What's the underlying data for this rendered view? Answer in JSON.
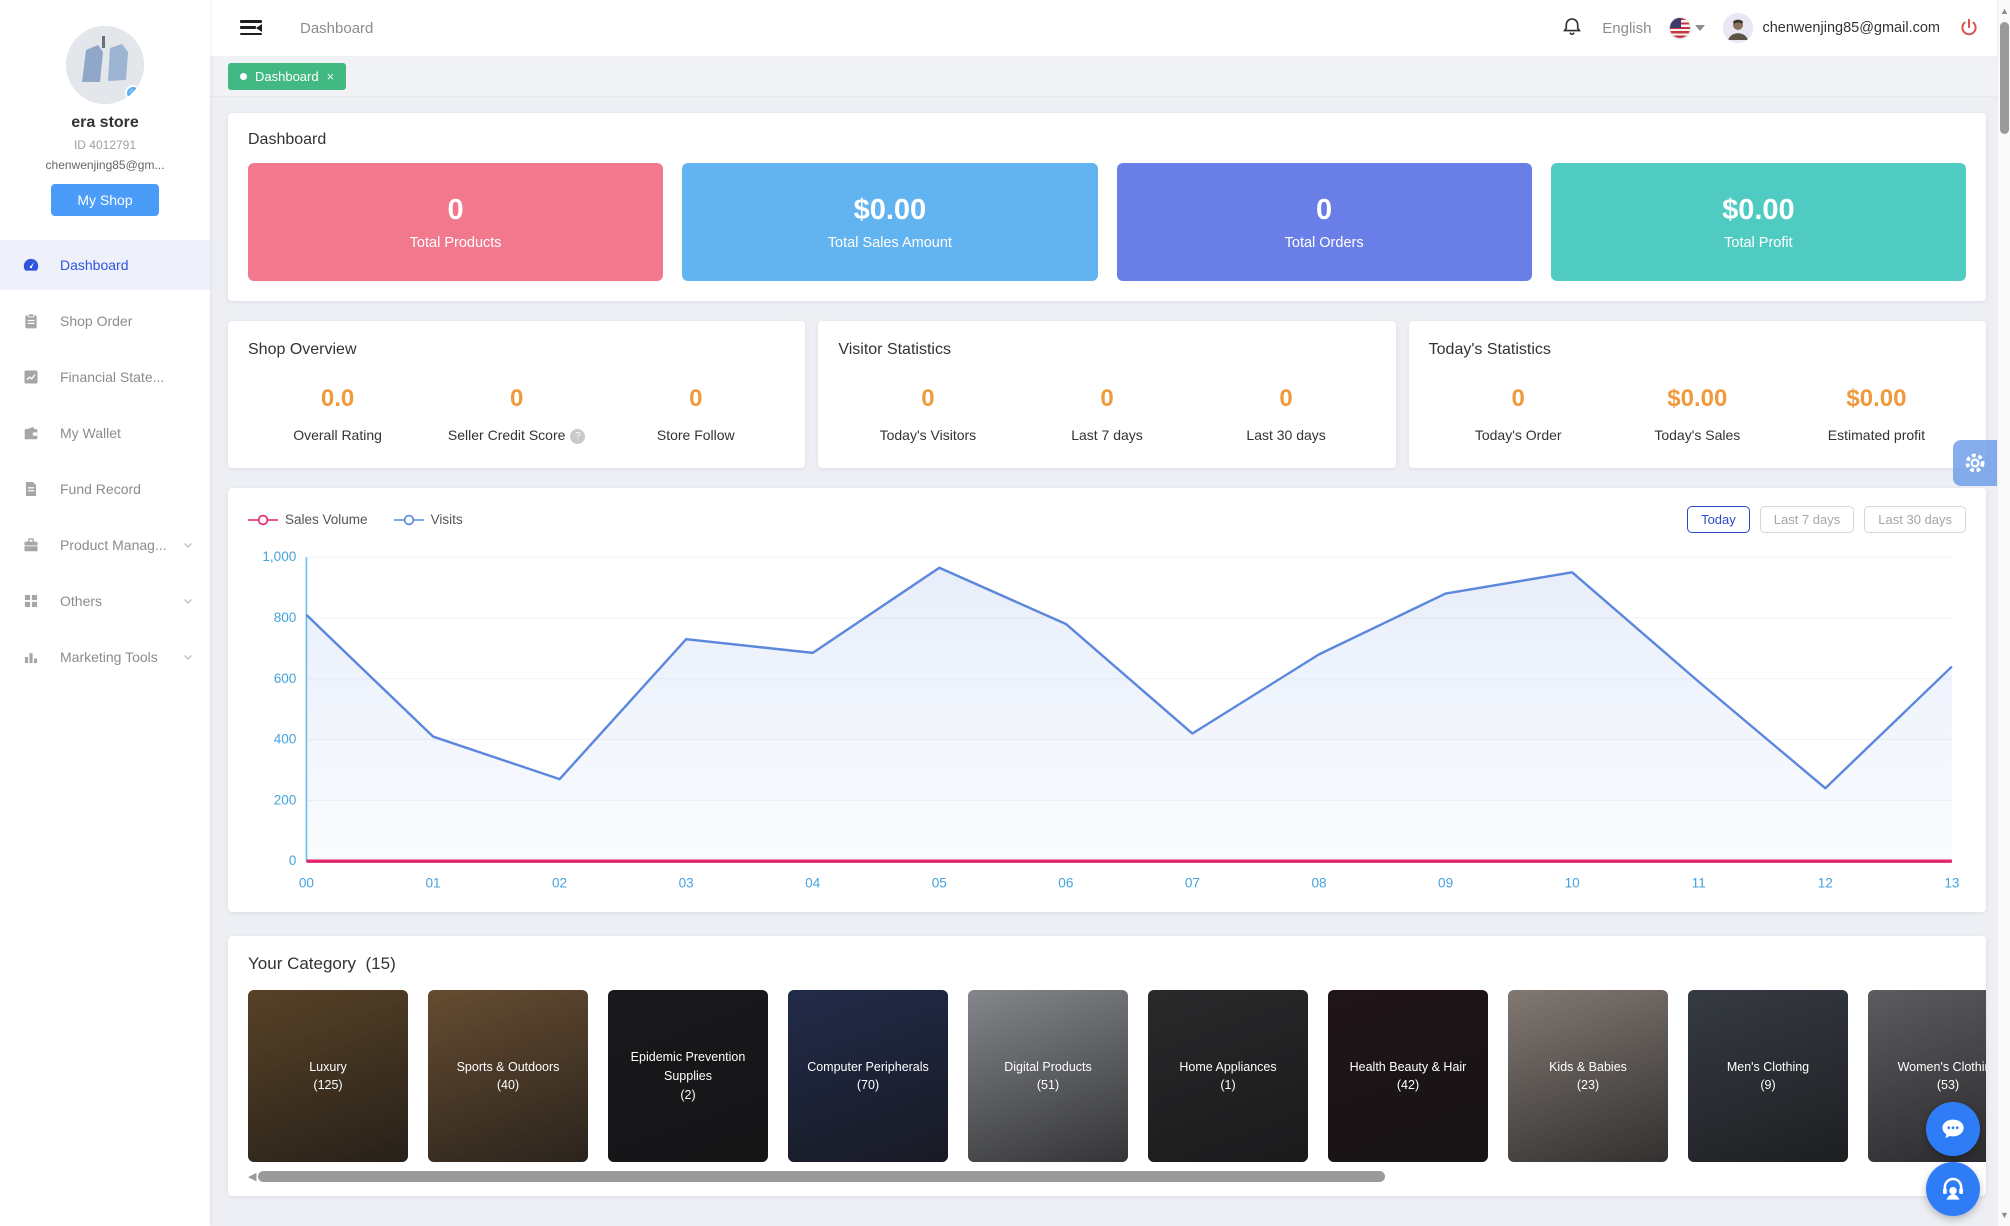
{
  "sidebar": {
    "store_name": "era store",
    "store_id": "ID 4012791",
    "email_short": "chenwenjing85@gm...",
    "my_shop_label": "My Shop",
    "items": [
      {
        "label": "Dashboard",
        "icon": "dashboard-icon",
        "active": true,
        "expandable": false
      },
      {
        "label": "Shop Order",
        "icon": "shop-order-icon",
        "active": false,
        "expandable": false
      },
      {
        "label": "Financial State...",
        "icon": "financial-statement-icon",
        "active": false,
        "expandable": false
      },
      {
        "label": "My Wallet",
        "icon": "wallet-icon",
        "active": false,
        "expandable": false
      },
      {
        "label": "Fund Record",
        "icon": "fund-record-icon",
        "active": false,
        "expandable": false
      },
      {
        "label": "Product Manag...",
        "icon": "product-management-icon",
        "active": false,
        "expandable": true
      },
      {
        "label": "Others",
        "icon": "others-icon",
        "active": false,
        "expandable": true
      },
      {
        "label": "Marketing Tools",
        "icon": "marketing-tools-icon",
        "active": false,
        "expandable": true
      }
    ]
  },
  "header": {
    "breadcrumb": "Dashboard",
    "language": "English",
    "email": "chenwenjing85@gmail.com"
  },
  "tabs": [
    {
      "label": "Dashboard",
      "active": true
    }
  ],
  "dashboard": {
    "title": "Dashboard",
    "stats": [
      {
        "value": "0",
        "label": "Total Products",
        "color": "#f1788d"
      },
      {
        "value": "$0.00",
        "label": "Total Sales Amount",
        "color": "#62b4f0"
      },
      {
        "value": "0",
        "label": "Total Orders",
        "color": "#6a7ee7"
      },
      {
        "value": "$0.00",
        "label": "Total Profit",
        "color": "#50cbc1"
      }
    ]
  },
  "overview_cards": [
    {
      "title": "Shop Overview",
      "metrics": [
        {
          "value": "0.0",
          "label": "Overall Rating",
          "help": false
        },
        {
          "value": "0",
          "label": "Seller Credit Score",
          "help": true
        },
        {
          "value": "0",
          "label": "Store Follow",
          "help": false
        }
      ]
    },
    {
      "title": "Visitor Statistics",
      "metrics": [
        {
          "value": "0",
          "label": "Today's Visitors",
          "help": false
        },
        {
          "value": "0",
          "label": "Last 7 days",
          "help": false
        },
        {
          "value": "0",
          "label": "Last 30 days",
          "help": false
        }
      ]
    },
    {
      "title": "Today's Statistics",
      "metrics": [
        {
          "value": "0",
          "label": "Today's Order",
          "help": false
        },
        {
          "value": "$0.00",
          "label": "Today's Sales",
          "help": false
        },
        {
          "value": "$0.00",
          "label": "Estimated profit",
          "help": false
        }
      ]
    }
  ],
  "chart_card": {
    "range_buttons": [
      {
        "label": "Today",
        "active": true
      },
      {
        "label": "Last 7 days",
        "active": false
      },
      {
        "label": "Last 30 days",
        "active": false
      }
    ]
  },
  "chart_data": {
    "type": "line",
    "title": "",
    "x": [
      "00",
      "01",
      "02",
      "03",
      "04",
      "05",
      "06",
      "07",
      "08",
      "09",
      "10",
      "11",
      "12",
      "13"
    ],
    "series": [
      {
        "name": "Sales Volume",
        "color": "#e0246d",
        "values": [
          0,
          0,
          0,
          0,
          0,
          0,
          0,
          0,
          0,
          0,
          0,
          0,
          0,
          0
        ]
      },
      {
        "name": "Visits",
        "color": "#5b87dd",
        "values": [
          810,
          410,
          270,
          730,
          685,
          965,
          780,
          420,
          680,
          880,
          950,
          590,
          240,
          640
        ]
      }
    ],
    "ylim": [
      0,
      1000
    ],
    "yticks": [
      0,
      200,
      400,
      600,
      800,
      1000
    ],
    "ytick_labels": [
      "0",
      "200",
      "400",
      "600",
      "800",
      "1,000"
    ],
    "axis_label_color": "#45a3dd",
    "grid": true,
    "legend_position": "top-left",
    "area_fill": true
  },
  "categories": {
    "title": "Your Category",
    "count": "(15)",
    "items": [
      {
        "name": "Luxury",
        "count": "(125)",
        "tone": "#7a5c36"
      },
      {
        "name": "Sports & Outdoors",
        "count": "(40)",
        "tone": "#8d6a44"
      },
      {
        "name": "Epidemic Prevention Supplies",
        "count": "(2)",
        "tone": "#232327"
      },
      {
        "name": "Computer Peripherals",
        "count": "(70)",
        "tone": "#2f3c66"
      },
      {
        "name": "Digital Products",
        "count": "(51)",
        "tone": "#b6bac0"
      },
      {
        "name": "Home Appliances",
        "count": "(1)",
        "tone": "#3a3a3d"
      },
      {
        "name": "Health Beauty & Hair",
        "count": "(42)",
        "tone": "#2c1c20"
      },
      {
        "name": "Kids & Babies",
        "count": "(23)",
        "tone": "#b3a79f"
      },
      {
        "name": "Men's Clothing",
        "count": "(9)",
        "tone": "#4b525c"
      },
      {
        "name": "Women's Clothing",
        "count": "(53)",
        "tone": "#808086"
      }
    ]
  },
  "icons": {
    "help-icon": "?",
    "close-icon": "×",
    "prev-arrow-icon": "◀",
    "scroll-up-icon": "▲",
    "scroll-down-icon": "▼",
    "caret-down-icon": "▾"
  },
  "colors": {
    "accent_blue": "#2e54e0",
    "tab_green": "#42b983",
    "metric_orange": "#ef9a3d",
    "my_shop_blue": "#4a9cf8",
    "logout_red": "#d9544f",
    "page_background": "#edeff4"
  }
}
